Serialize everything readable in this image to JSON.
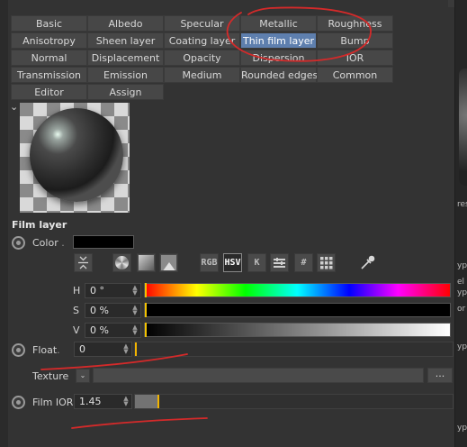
{
  "tabs": [
    [
      "Basic",
      "Albedo",
      "Specular",
      "Metallic",
      "Roughness"
    ],
    [
      "Anisotropy",
      "Sheen layer",
      "Coating layer",
      "Thin film layer",
      "Bump"
    ],
    [
      "Normal",
      "Displacement",
      "Opacity",
      "Dispersion",
      "IOR"
    ],
    [
      "Transmission",
      "Emission",
      "Medium",
      "Rounded edges",
      "Common"
    ],
    [
      "Editor",
      "Assign"
    ]
  ],
  "active_tab": "Thin film layer",
  "section_title": "Film layer",
  "color": {
    "label": "Color",
    "dots": ".",
    "swatch_color": "#000000",
    "tools": [
      "arrows-icon",
      "color-wheel-icon",
      "gradient-square-icon",
      "image-icon",
      "RGB",
      "HSV",
      "K",
      "sliders-icon",
      "#",
      "grid-icon",
      "eyedropper-icon"
    ],
    "tool_text": {
      "rgb": "RGB",
      "hsv": "HSV",
      "k": "K",
      "hash": "#"
    },
    "selected_tool": "HSV",
    "h": {
      "label": "H",
      "value": "0 °"
    },
    "s": {
      "label": "S",
      "value": "0 %"
    },
    "v": {
      "label": "V",
      "value": "0 %"
    }
  },
  "float": {
    "label": "Float",
    "dots": ".",
    "value": "0",
    "fraction": 0.0
  },
  "texture": {
    "label": "Texture",
    "button_label": "..."
  },
  "film_ior": {
    "label": "Film IOR",
    "value": "1.45",
    "fraction": 0.07
  },
  "right_panel_fragments": [
    "res",
    "ype",
    "el",
    "ype",
    "or",
    "ype",
    "ype"
  ],
  "colors": {
    "accent_tab": "#5e7fae",
    "annotation_red": "#d42a2a",
    "marker_yellow": "#f2c200"
  }
}
